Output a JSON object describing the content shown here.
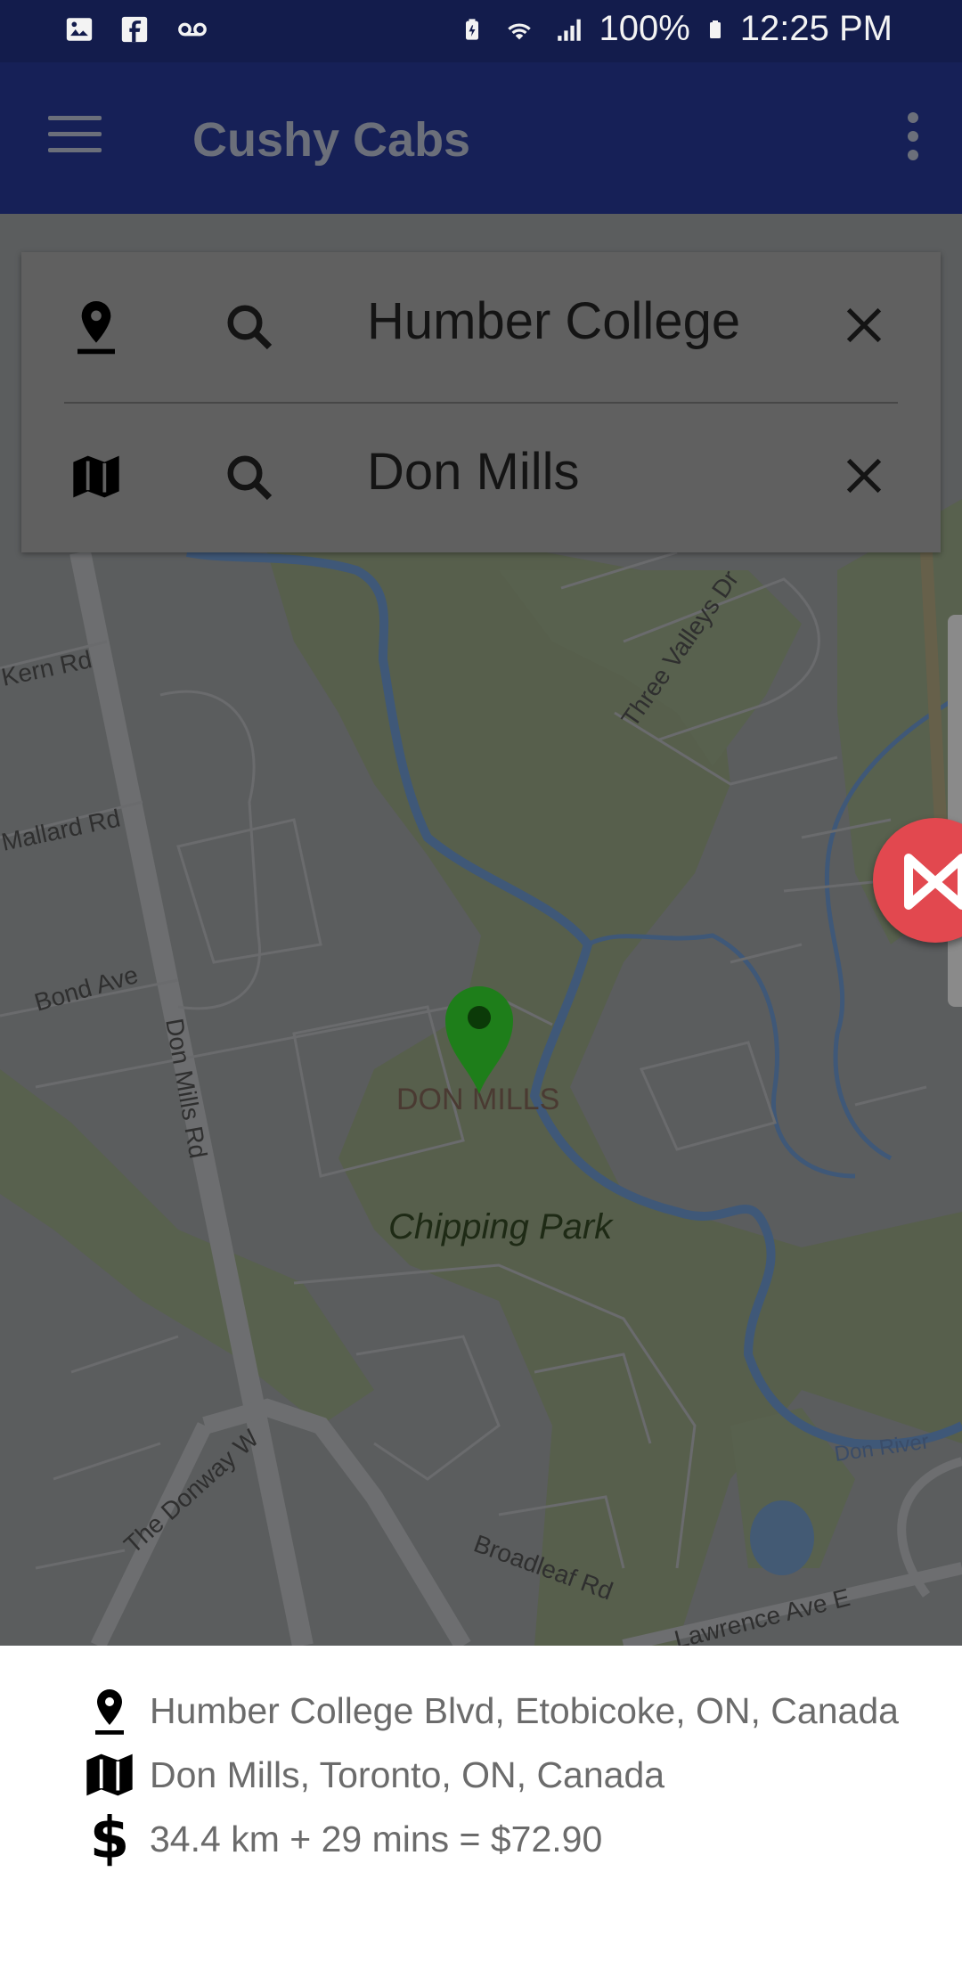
{
  "status_bar": {
    "battery": "100%",
    "time": "12:25 PM",
    "left_icons": [
      "gallery-icon",
      "facebook-icon",
      "voicemail-icon"
    ],
    "right_icons": [
      "battery-saver-icon",
      "wifi-icon",
      "signal-icon",
      "battery-icon"
    ]
  },
  "app_bar": {
    "title": "Cushy Cabs",
    "left_icon": "menu-icon",
    "right_icon": "more-vert-icon",
    "background": "#162057"
  },
  "search": {
    "from_value": "Humber College",
    "to_value": "Don Mills",
    "from_icon": "place-icon",
    "to_icon": "map-icon",
    "search_icon": "search-icon",
    "clear_icon": "close-icon"
  },
  "map": {
    "labels": {
      "kern": "Kern Rd",
      "mallard": "Mallard Rd",
      "bond": "Bond Ave",
      "donmills_rd": "Don Mills Rd",
      "three_valleys": "Three Valleys Dr",
      "place": "DON MILLS",
      "park": "Chipping Park",
      "donway": "The Donway W",
      "broadleaf": "Broadleaf Rd",
      "don_river": "Don River",
      "lawrence": "Lawrence Ave E"
    },
    "marker_color": "#1e7e1a"
  },
  "trip": {
    "pickup": "Humber College Blvd, Etobicoke, ON, Canada",
    "dropoff": "Don Mills, Toronto, ON, Canada",
    "fare": "34.4 km + 29 mins = $72.90",
    "pickup_icon": "place-icon",
    "dropoff_icon": "map-icon",
    "fare_icon": "dollar-icon",
    "dollar_symbol": "$"
  }
}
